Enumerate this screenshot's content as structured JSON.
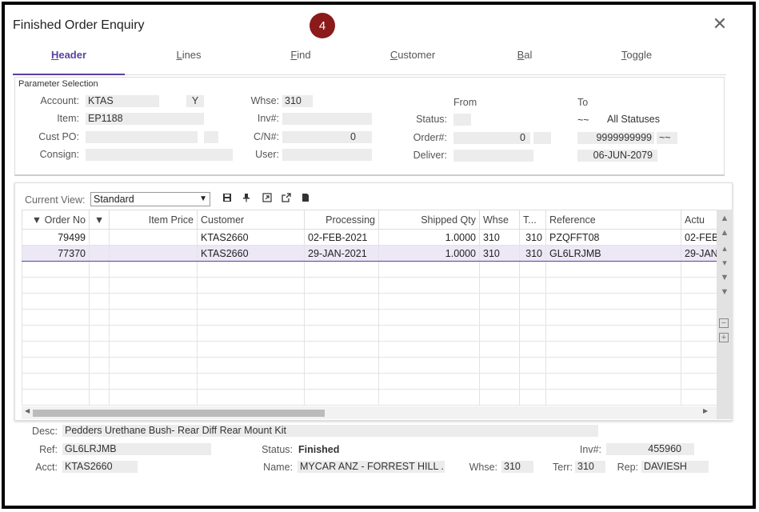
{
  "window": {
    "title": "Finished Order Enquiry",
    "badge": "4",
    "close": "✕"
  },
  "tabs": [
    {
      "label": "Header",
      "mnemonic": "H",
      "rest": "eader"
    },
    {
      "label": "Lines",
      "mnemonic": "L",
      "rest": "ines"
    },
    {
      "label": "Find",
      "mnemonic": "F",
      "rest": "ind"
    },
    {
      "label": "Customer",
      "mnemonic": "C",
      "rest": "ustomer"
    },
    {
      "label": "Bal",
      "mnemonic": "B",
      "rest": "al"
    },
    {
      "label": "Toggle",
      "mnemonic": "T",
      "rest": "oggle"
    }
  ],
  "params": {
    "title": "Parameter Selection",
    "account_label": "Account:",
    "account": "KTAS",
    "account_flag": "Y",
    "item_label": "Item:",
    "item": "EP1188",
    "custpo_label": "Cust PO:",
    "consign_label": "Consign:",
    "whse_label": "Whse:",
    "whse": "310",
    "inv_label": "Inv#:",
    "cn_label": "C/N#:",
    "cn": "0",
    "user_label": "User:",
    "from_label": "From",
    "to_label": "To",
    "status_label": "Status:",
    "status_to_prefix": "~~",
    "status_to": "All Statuses",
    "order_label": "Order#:",
    "order_from": "0",
    "order_to": "9999999999",
    "order_to_suffix": "~~",
    "deliver_label": "Deliver:",
    "deliver_to": "06-JUN-2079"
  },
  "grid": {
    "current_view_label": "Current View:",
    "current_view": "Standard",
    "columns": [
      "▼ Order No",
      "▼",
      "Item Price",
      "Customer",
      "Processing",
      "Shipped Qty",
      "Whse",
      "T...",
      "Reference",
      "Actu"
    ],
    "rows": [
      [
        "79499",
        "",
        "",
        "KTAS2660",
        "02-FEB-2021",
        "1.0000",
        "310",
        "310",
        "PZQFFT08",
        "02-FEB"
      ],
      [
        "77370",
        "",
        "",
        "KTAS2660",
        "29-JAN-2021",
        "1.0000",
        "310",
        "310",
        "GL6LRJMB",
        "29-JAN"
      ]
    ],
    "empty_rows": 9
  },
  "footer": {
    "desc_label": "Desc:",
    "desc": "Pedders Urethane Bush- Rear  Diff Rear Mount Kit",
    "ref_label": "Ref:",
    "ref": "GL6LRJMB",
    "status_label": "Status:",
    "status": "Finished",
    "inv_label": "Inv#:",
    "inv": "455960",
    "acct_label": "Acct:",
    "acct": "KTAS2660",
    "name_label": "Name:",
    "name": "MYCAR ANZ - FORREST HILL ...",
    "whse_label": "Whse:",
    "whse": "310",
    "terr_label": "Terr:",
    "terr": "310",
    "rep_label": "Rep:",
    "rep": "DAVIESH"
  }
}
